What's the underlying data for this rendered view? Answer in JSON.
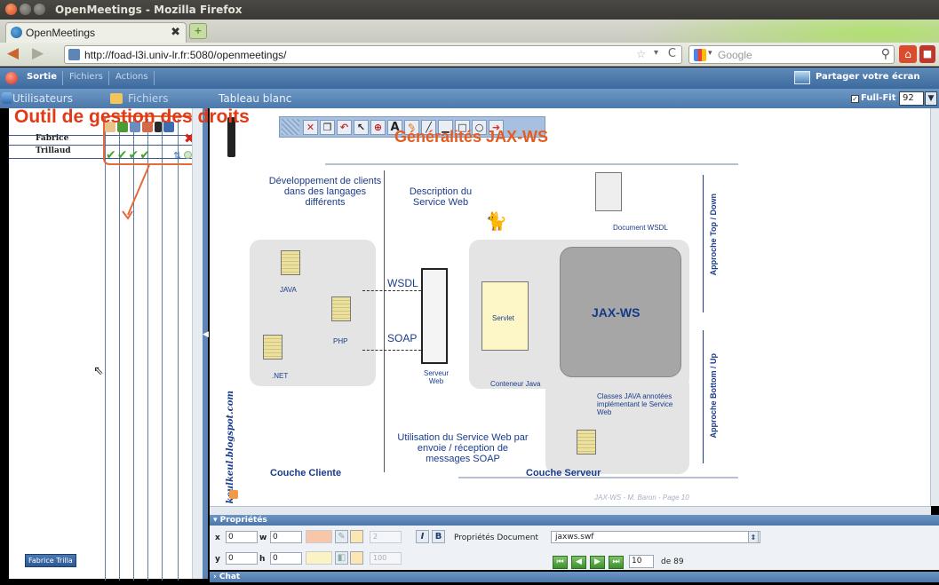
{
  "window": {
    "title": "OpenMeetings - Mozilla Firefox"
  },
  "browser": {
    "tab_title": "OpenMeetings",
    "tab_close": "✖",
    "new_tab": "+",
    "url": "http://foad-l3i.univ-lr.fr:5080/openmeetings/",
    "search_placeholder": "Google"
  },
  "app_menu": {
    "sortie": "Sortie",
    "fichiers": "Fichiers",
    "actions": "Actions",
    "share_screen": "Partager votre écran"
  },
  "sub_header": {
    "users_tab": "Utilisateurs",
    "files_tab": "Fichiers",
    "whiteboard_title": "Tableau blanc",
    "fullfit_label": "Full-Fit",
    "zoom_value": "92"
  },
  "users": [
    {
      "name": "Fabrice"
    },
    {
      "name": "Trillaud"
    }
  ],
  "rights_callout": "Outil de gestion des droits",
  "user_chip": "Fabrice Trilla",
  "slide": {
    "title": "Généralités JAX-WS",
    "dev_clients": "Développement de clients dans des langages différents",
    "description": "Description du Service Web",
    "doc_wsdl": "Document WSDL",
    "java": "JAVA",
    "php": "PHP",
    "net": ".NET",
    "wsdl": "WSDL",
    "soap": "SOAP",
    "servlet": "Servlet",
    "jaxws": "JAX-WS",
    "serveur_web": "Serveur Web",
    "conteneur": "Conteneur Java",
    "classes": "Classes JAVA annotées implémentant le Service Web",
    "utilisation": "Utilisation du Service Web par envoie / réception de messages SOAP",
    "couche_cliente": "Couche Cliente",
    "couche_serveur": "Couche Serveur",
    "approche_top": "Approche Top / Down",
    "approche_bottom": "Approche Bottom / Up",
    "blog": "keulkeul.blogspot.com",
    "footer": "JAX-WS - M. Baron - Page 10"
  },
  "properties": {
    "header": "Propriétés",
    "x_label": "x",
    "x_value": "0",
    "y_label": "y",
    "y_value": "0",
    "w_label": "w",
    "w_value": "0",
    "h_label": "h",
    "h_value": "0",
    "line_width": "2",
    "opacity": "100",
    "doc_props_label": "Propriétés Document",
    "doc_name": "jaxws.swf",
    "page_value": "10",
    "page_total": "de 89",
    "italic": "I",
    "bold": "B"
  },
  "chat": {
    "header": "Chat"
  },
  "colors": {
    "accent": "#4c79ab",
    "callout": "#e03a17",
    "check": "#41a527"
  }
}
